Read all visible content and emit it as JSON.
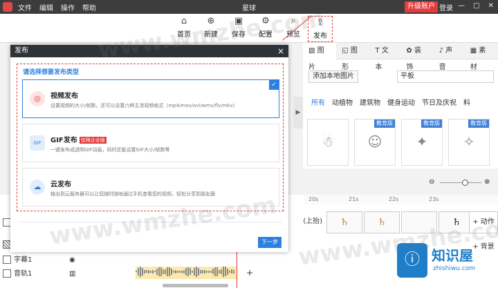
{
  "titlebar": {
    "title": "星球",
    "menu": [
      "文件",
      "编辑",
      "操作",
      "帮助"
    ],
    "upgrade": "升级账户",
    "login": "登录"
  },
  "toolbar": [
    {
      "label": "首页",
      "icon": "home-icon"
    },
    {
      "label": "新建",
      "icon": "new-icon"
    },
    {
      "label": "保存",
      "icon": "save-icon"
    },
    {
      "label": "配置",
      "icon": "gear-icon"
    },
    {
      "label": "预览",
      "icon": "search-icon"
    },
    {
      "label": "发布",
      "icon": "publish-icon"
    }
  ],
  "right_panel": {
    "tabs": [
      "图片",
      "图形",
      "文本",
      "装饰",
      "声音",
      "素材"
    ],
    "add_local": "添加本地图片",
    "search_value": "平板",
    "categories": [
      "所有",
      "动植物",
      "建筑物",
      "健身运动",
      "节日及庆祝",
      "料"
    ],
    "badge": "教育版"
  },
  "dialog": {
    "title": "发布",
    "prompt": "请选择想要发布类型",
    "options": [
      {
        "title": "视频发布",
        "desc": "设置视频的大小/帧数，还可以设置六种主流视频格式（mp4/mov/avi/wmv/flv/mkv）"
      },
      {
        "title": "GIF发布",
        "badge": "仅限企业版",
        "desc": "一键发布成透明GIF动画，同时还能设置GIF大小/帧数等"
      },
      {
        "title": "云发布",
        "desc": "输出到云服务器可以让您随时随地通过手机查看您的视频，轻松分享到朋友圈"
      }
    ],
    "next": "下一步"
  },
  "timeline": {
    "ruler": [
      "20s",
      "21s",
      "22s",
      "23s"
    ],
    "clip_label": "(上抬)",
    "action": "+ 动作",
    "background": "+ 背景",
    "rows": [
      {
        "label": "字幕1"
      },
      {
        "label": "音轨1"
      }
    ]
  },
  "logo": {
    "name": "知识屋",
    "sub": "zhishiwu.com"
  },
  "watermark": "www.wmzhe.com",
  "colors": {
    "accent": "#2d7fe0",
    "highlight": "#e23a3a",
    "titlebar": "#3c3c3c"
  }
}
